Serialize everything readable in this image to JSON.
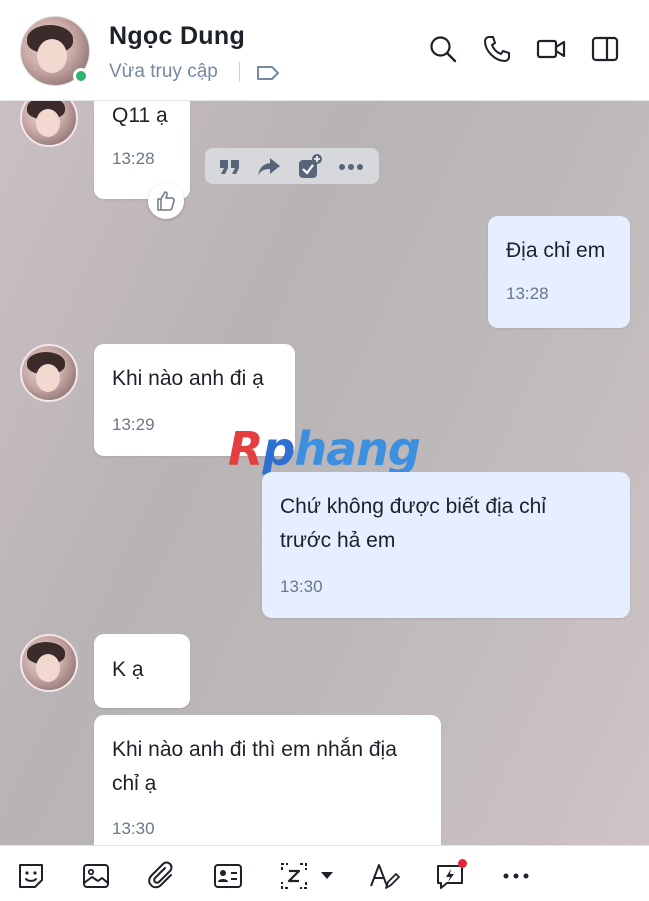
{
  "header": {
    "contact_name": "Ngọc Dung",
    "status": "Vừa truy cập",
    "icons": [
      "search-icon",
      "phone-icon",
      "video-call-icon",
      "side-panel-icon",
      "tag-icon"
    ]
  },
  "messages": [
    {
      "from": "other",
      "text": "Q11 ạ",
      "time": "13:28"
    },
    {
      "from": "me",
      "text": "Địa chỉ em",
      "time": "13:28"
    },
    {
      "from": "other",
      "text": "Khi nào anh đi ạ",
      "time": "13:29"
    },
    {
      "from": "me",
      "text_line1": "Chứ không được biết địa chỉ",
      "text_line2": "trước hả em",
      "time": "13:30"
    },
    {
      "from": "other",
      "text": "K ạ"
    },
    {
      "from": "other",
      "text_line1": "Khi nào anh đi thì em nhắn địa",
      "text_line2": "chỉ ạ",
      "time": "13:30"
    }
  ],
  "message_actions": [
    "quote-icon",
    "forward-icon",
    "add-task-icon",
    "more-icon"
  ],
  "watermark": {
    "r": "R",
    "p": "p",
    "rest": "hang"
  },
  "toolbar": {
    "icons": [
      "sticker-icon",
      "image-icon",
      "attachment-icon",
      "contact-card-icon",
      "screenshot-icon",
      "format-text-icon",
      "quick-message-icon",
      "more-icon"
    ]
  },
  "colors": {
    "accent": "#0068ff",
    "online": "#2fb36e",
    "my_bubble": "#e5efff",
    "icon": "#1d2129"
  }
}
